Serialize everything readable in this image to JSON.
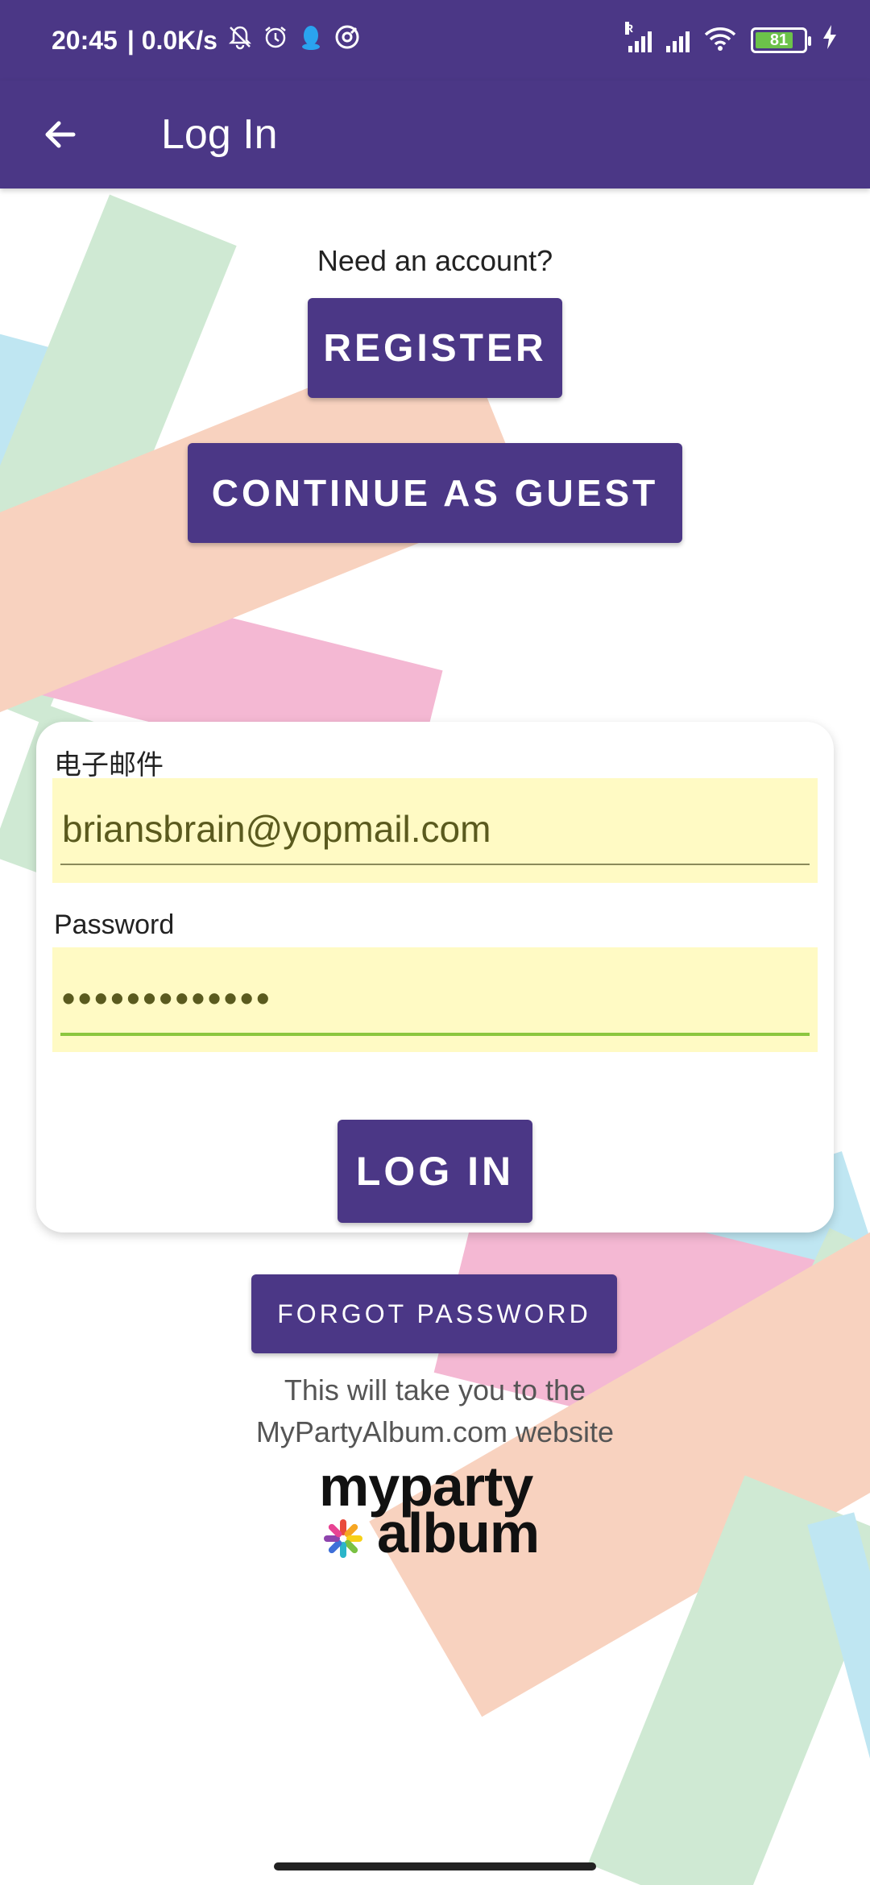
{
  "status_bar": {
    "time": "20:45",
    "net_speed": "| 0.0K/s",
    "battery_level": "81",
    "signal_roaming_label": "R",
    "icons": [
      "mute-bell-icon",
      "alarm-icon",
      "qq-icon",
      "vpn-icon",
      "signal-icon",
      "signal-icon",
      "wifi-icon",
      "battery-icon",
      "charging-icon"
    ]
  },
  "app_bar": {
    "title": "Log In",
    "back_icon": "arrow-back-icon"
  },
  "register_section": {
    "prompt": "Need an account?",
    "register_label": "REGISTER",
    "guest_label": "CONTINUE AS GUEST"
  },
  "login_form": {
    "email_label": "电子邮件",
    "email_value": "briansbrain@yopmail.com",
    "password_label": "Password",
    "password_value": "•••••••••••••",
    "login_label": "LOG IN"
  },
  "forgot": {
    "label": "FORGOT PASSWORD",
    "note_line1": "This will take you to the",
    "note_line2": "MyPartyAlbum.com website"
  },
  "logo": {
    "line1": "myparty",
    "line2": "album"
  },
  "colors": {
    "primary": "#4b3786",
    "field_bg": "#fffac4",
    "active_underline": "#8cc63f"
  }
}
